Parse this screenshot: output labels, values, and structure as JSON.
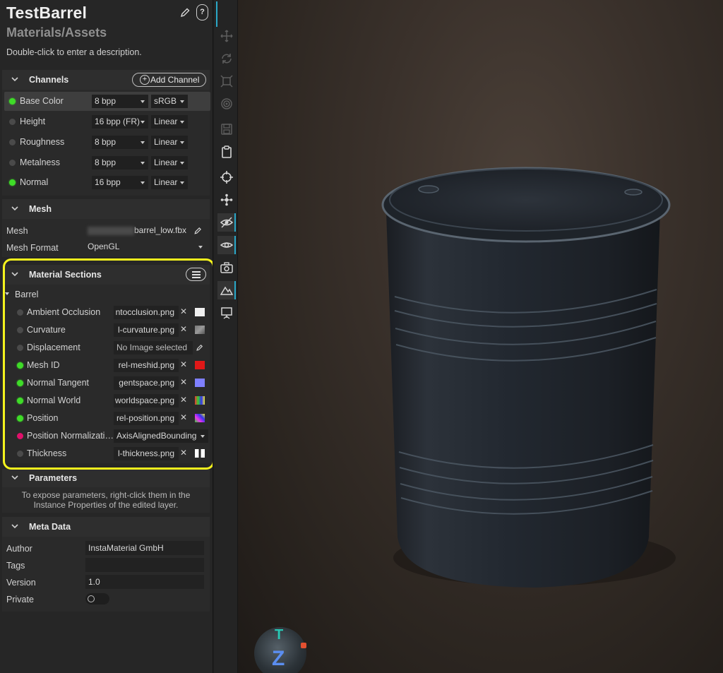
{
  "header": {
    "title": "TestBarrel",
    "subtitle": "Materials/Assets",
    "description": "Double-click to enter a description.",
    "help_label": "?"
  },
  "channels": {
    "title": "Channels",
    "add_label": "Add Channel",
    "rows": [
      {
        "name": "Base Color",
        "format": "8 bpp",
        "space": "sRGB",
        "active": true
      },
      {
        "name": "Height",
        "format": "16 bpp (FR)",
        "space": "Linear",
        "active": false
      },
      {
        "name": "Roughness",
        "format": "8 bpp",
        "space": "Linear",
        "active": false
      },
      {
        "name": "Metalness",
        "format": "8 bpp",
        "space": "Linear",
        "active": false
      },
      {
        "name": "Normal",
        "format": "16 bpp",
        "space": "Linear",
        "active": true
      }
    ]
  },
  "mesh": {
    "title": "Mesh",
    "mesh_label": "Mesh",
    "mesh_value": "barrel_low.fbx",
    "format_label": "Mesh Format",
    "format_value": "OpenGL"
  },
  "material_sections": {
    "title": "Material Sections",
    "group": "Barrel",
    "rows": [
      {
        "name": "Ambient Occlusion",
        "file": "ntocclusion.png",
        "status": "off",
        "thumb": "white"
      },
      {
        "name": "Curvature",
        "file": "l-curvature.png",
        "status": "off",
        "thumb": "gray"
      },
      {
        "name": "Displacement",
        "file": "No Image selected",
        "status": "off",
        "thumb": "none"
      },
      {
        "name": "Mesh ID",
        "file": "rel-meshid.png",
        "status": "on",
        "thumb": "red"
      },
      {
        "name": "Normal Tangent",
        "file": "gentspace.png",
        "status": "on",
        "thumb": "blue"
      },
      {
        "name": "Normal World",
        "file": "worldspace.png",
        "status": "on",
        "thumb": "rainbow"
      },
      {
        "name": "Position",
        "file": "rel-position.png",
        "status": "on",
        "thumb": "rainbow"
      },
      {
        "name": "Position Normalizati…",
        "file": "AxisAlignedBounding",
        "status": "error",
        "thumb": "none"
      },
      {
        "name": "Thickness",
        "file": "l-thickness.png",
        "status": "off",
        "thumb": "bw"
      }
    ]
  },
  "parameters": {
    "title": "Parameters",
    "note_line1": "To expose parameters, right-click them in the",
    "note_line2": "Instance Properties of the edited layer."
  },
  "meta": {
    "title": "Meta Data",
    "author_label": "Author",
    "author_value": "InstaMaterial GmbH",
    "tags_label": "Tags",
    "tags_value": "",
    "version_label": "Version",
    "version_value": "1.0",
    "private_label": "Private"
  },
  "viewport": {
    "gizmo_top": "T",
    "gizmo_axis": "Z"
  },
  "colors": {
    "accent": "#2aa8c8",
    "active_dot": "#3fdc28",
    "error_dot": "#e0106a",
    "highlight": "#f5f31d"
  }
}
